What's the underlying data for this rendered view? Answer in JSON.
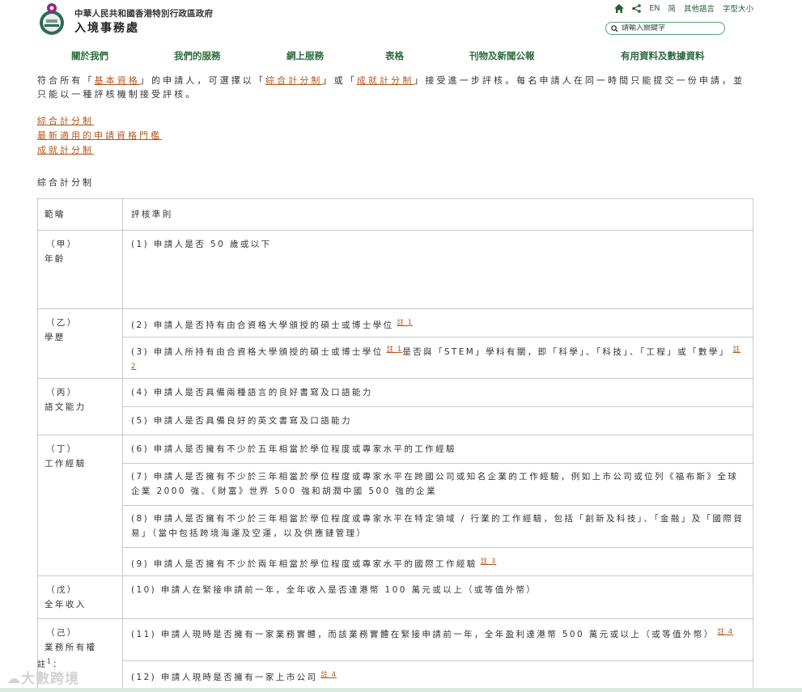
{
  "header": {
    "gov_name": "中華人民共和國香港特別行政區政府",
    "dept_name": "入境事務處",
    "utility": {
      "lang_en": "EN",
      "lang_sc": "简",
      "other_lang": "其他語言",
      "font_size": "字型大小"
    },
    "search": {
      "placeholder": "請輸入關鍵字"
    }
  },
  "nav": {
    "items": [
      "關於我們",
      "我們的服務",
      "網上服務",
      "表格",
      "刊物及新聞公報",
      "有用資料及數據資料"
    ]
  },
  "intro": {
    "p1": "符合所有「",
    "link_basic": "基本資格",
    "p2": "」的申請人，可選擇以「",
    "link_general": "綜合計分制",
    "p3": "」或「",
    "link_achievement": "成就計分制",
    "p4": "」接受進一步評核。每名申請人在同一時間只能提交一份申請，並只能以一種評核機制接受評核。"
  },
  "quick_links": [
    "綜合計分制",
    "最新適用的申請資格門檻",
    "成就計分制"
  ],
  "section_title": "綜合計分制",
  "table": {
    "headers": [
      "範疇",
      "評核準則"
    ],
    "groups": [
      {
        "code": "（甲）",
        "name": "年齡",
        "rows": [
          {
            "text": "(1) 申請人是否 50 歲或以下"
          }
        ]
      },
      {
        "code": "（乙）",
        "name": "學歷",
        "rows": [
          {
            "text": "(2) 申請人是否持有由合資格大學頒授的碩士或博士學位",
            "note": "註 1"
          },
          {
            "text": "(3) 申請人所持有由合資格大學頒授的碩士或博士學位",
            "note_mid": "註 1",
            "text2": "是否與「STEM」學科有關，即「科學」、「科技」、「工程」或「數學」",
            "note": "註 2"
          }
        ]
      },
      {
        "code": "（丙）",
        "name": "語文能力",
        "rows": [
          {
            "text": "(4) 申請人是否具備兩種語言的良好書寫及口語能力"
          },
          {
            "text": "(5) 申請人是否具備良好的英文書寫及口語能力"
          }
        ]
      },
      {
        "code": "（丁）",
        "name": "工作經驗",
        "rows": [
          {
            "text": "(6) 申請人是否擁有不少於五年相當於學位程度或專家水平的工作經驗"
          },
          {
            "text": "(7) 申請人是否擁有不少於三年相當於學位程度或專家水平在跨國公司或知名企業的工作經驗，例如上市公司或位列《福布斯》全球企業 2000 強、《財富》世界 500 強和胡潤中國 500 強的企業"
          },
          {
            "text": "(8) 申請人是否擁有不少於三年相當於學位程度或專家水平在特定領域 / 行業的工作經驗，包括「創新及科技」、「金融」及「國際貿易」（當中包括跨境海運及空運，以及供應鏈管理）"
          },
          {
            "text": "(9) 申請人是否擁有不少於兩年相當於學位程度或專家水平的國際工作經驗",
            "note": "註 3"
          }
        ]
      },
      {
        "code": "（戊）",
        "name": "全年收入",
        "rows": [
          {
            "text": "(10) 申請人在緊接申請前一年，全年收入是否達港幣 100 萬元或以上（或等值外幣）"
          }
        ]
      },
      {
        "code": "（己）",
        "name": "業務所有權",
        "rows": [
          {
            "text": "(11) 申請人現時是否擁有一家業務實體，而該業務實體在緊接申請前一年，全年盈利達港幣 500 萬元或以上（或等值外幣）",
            "note": "註 4"
          },
          {
            "text": "(12) 申請人現時是否擁有一家上市公司",
            "note": "註 4"
          }
        ]
      }
    ]
  },
  "footnote": {
    "label": "註",
    "num": "1",
    "suffix": "："
  },
  "watermark": "大數跨境",
  "colors": {
    "link": "#b5561b",
    "nav": "#2e6b3d",
    "accent": "#5aa27c",
    "border": "#c9c9c9"
  }
}
